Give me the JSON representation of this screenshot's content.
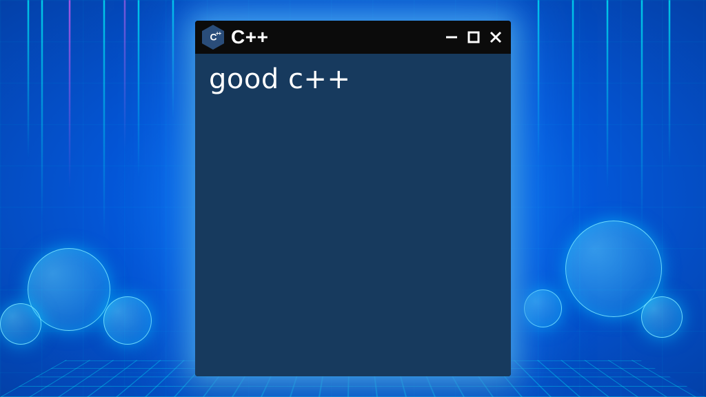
{
  "window": {
    "title": "C++",
    "icon_label": "C",
    "icon_plus": "++",
    "content_text": "good c++"
  },
  "controls": {
    "minimize": "Minimize",
    "maximize": "Maximize",
    "close": "Close"
  },
  "colors": {
    "titlebar_bg": "#0b0b0b",
    "content_bg": "#173a5e",
    "glow": "#50b4ff"
  }
}
